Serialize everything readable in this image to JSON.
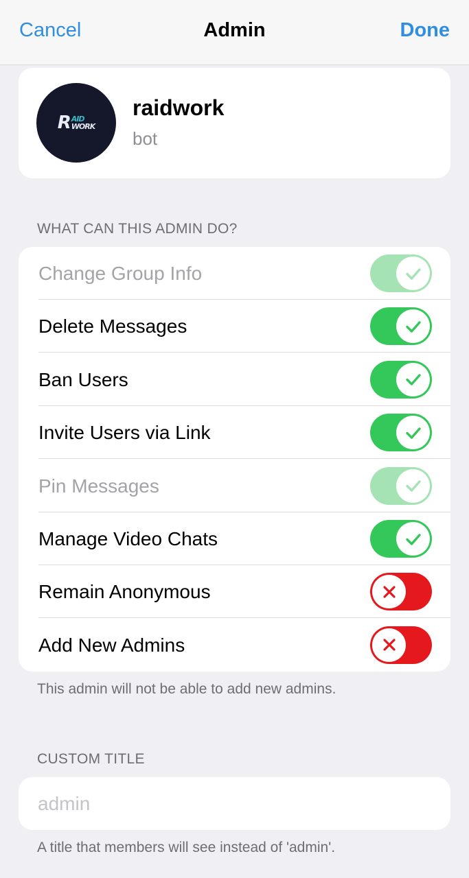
{
  "nav": {
    "cancel": "Cancel",
    "title": "Admin",
    "done": "Done"
  },
  "profile": {
    "name": "raidwork",
    "subtitle": "bot",
    "avatar_logo": {
      "big": "R",
      "top": "AID",
      "bottom": "WORK"
    }
  },
  "permissions": {
    "header": "WHAT CAN THIS ADMIN DO?",
    "items": [
      {
        "label": "Change Group Info",
        "state": "on",
        "disabled": true
      },
      {
        "label": "Delete Messages",
        "state": "on",
        "disabled": false
      },
      {
        "label": "Ban Users",
        "state": "on",
        "disabled": false
      },
      {
        "label": "Invite Users via Link",
        "state": "on",
        "disabled": false
      },
      {
        "label": "Pin Messages",
        "state": "on",
        "disabled": true
      },
      {
        "label": "Manage Video Chats",
        "state": "on",
        "disabled": false
      },
      {
        "label": "Remain Anonymous",
        "state": "off",
        "disabled": false
      },
      {
        "label": "Add New Admins",
        "state": "off",
        "disabled": false
      }
    ],
    "footer": "This admin will not be able to add new admins."
  },
  "custom_title": {
    "header": "CUSTOM TITLE",
    "value": "",
    "placeholder": "admin",
    "footer": "A title that members will see instead of 'admin'."
  },
  "colors": {
    "accent": "#2f8ee0",
    "toggle_on": "#34c759",
    "toggle_on_disabled": "#a6e3b4",
    "toggle_off": "#e5191d"
  }
}
